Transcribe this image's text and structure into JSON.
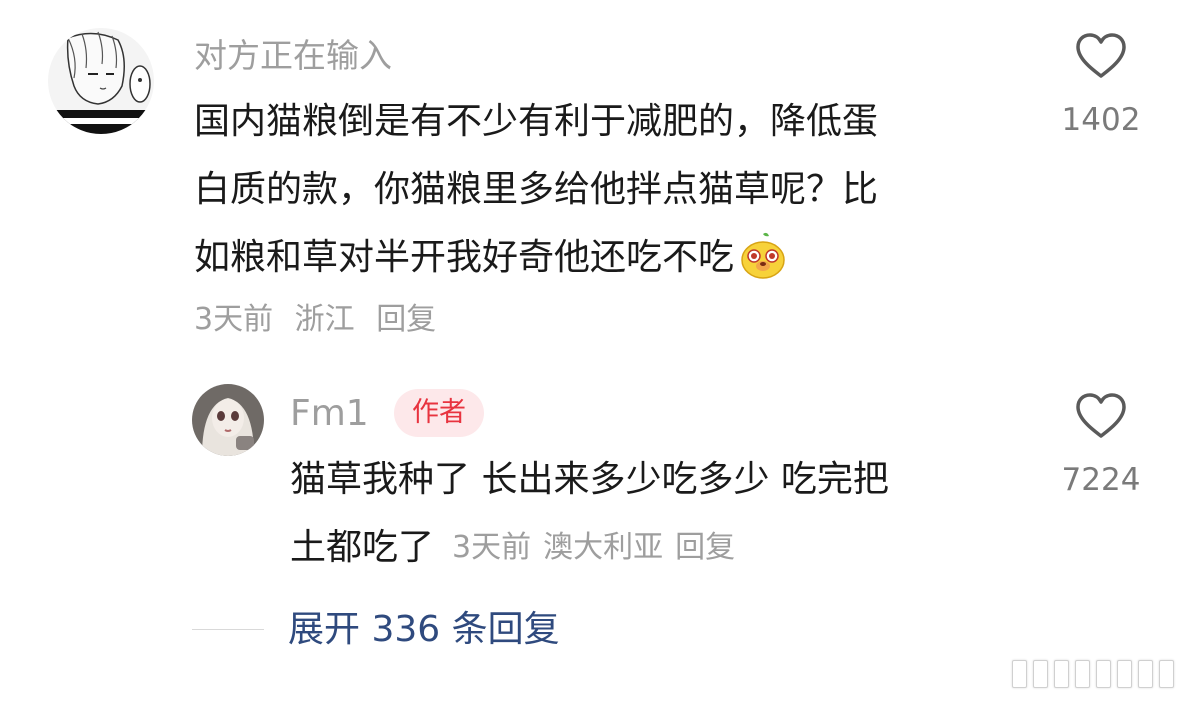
{
  "main_comment": {
    "username": "对方正在输入",
    "text_lines": [
      "国内猫粮倒是有不少有利于减肥的，降低蛋",
      "白质的款，你猫粮里多给他拌点猫草呢？比",
      "如粮和草对半开我好奇他还吃不吃"
    ],
    "emoji": "dog-face-emoji",
    "time": "3天前",
    "location": "浙江",
    "reply_label": "回复",
    "like_count": "1402",
    "like_icon": "heart-outline-icon"
  },
  "reply_comment": {
    "username": "Fm1",
    "badge": "作者",
    "text_lines": [
      "猫草我种了 长出来多少吃多少 吃完把",
      "土都吃了"
    ],
    "time": "3天前",
    "location": "澳大利亚",
    "reply_label": "回复",
    "like_count": "7224",
    "like_icon": "heart-outline-icon"
  },
  "expand": {
    "label": "展开 336 条回复"
  },
  "colors": {
    "text": "#1a1a1a",
    "muted": "#9e9e9e",
    "badge_bg": "#fde8ea",
    "badge_text": "#e8333f",
    "link": "#2f4a7e"
  }
}
